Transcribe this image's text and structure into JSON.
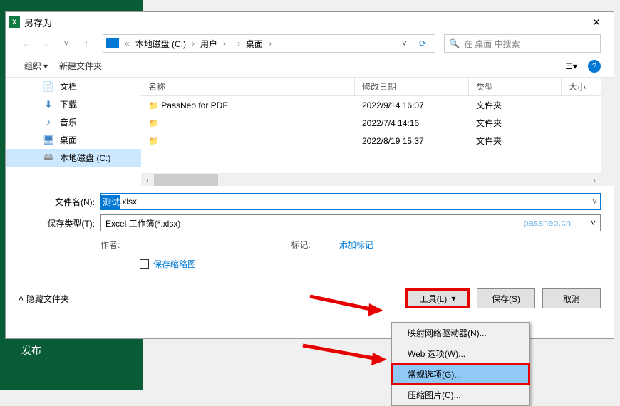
{
  "bg": {
    "publish": "发布"
  },
  "dialog": {
    "title": "另存为",
    "close": "✕"
  },
  "nav": {
    "back": "←",
    "fwd": "→",
    "dd": "˅",
    "up": "↑",
    "crumbs": {
      "c1": "本地磁盘 (C:)",
      "c2": "用户",
      "c3_redacted": "      ",
      "c4": "桌面"
    },
    "refresh": "⟳",
    "search_placeholder": "在 桌面 中搜索"
  },
  "toolbar": {
    "organize": "组织",
    "newfolder": "新建文件夹"
  },
  "sidebar": {
    "items": [
      {
        "icon": "📄",
        "label": "文档",
        "color": "#3b82c4"
      },
      {
        "icon": "⬇",
        "label": "下载",
        "color": "#3b82c4"
      },
      {
        "icon": "♪",
        "label": "音乐",
        "color": "#3b82c4"
      },
      {
        "icon": "🖥",
        "label": "桌面",
        "color": "#3b82c4"
      },
      {
        "icon": "🖴",
        "label": "本地磁盘 (C:)",
        "color": "#888"
      }
    ]
  },
  "files": {
    "cols": {
      "name": "名称",
      "date": "修改日期",
      "type": "类型",
      "size": "大小"
    },
    "rows": [
      {
        "name": "PassNeo for PDF",
        "date": "2022/9/14 16:07",
        "type": "文件夹"
      },
      {
        "name": " ",
        "date": "2022/7/4 14:16",
        "type": "文件夹"
      },
      {
        "name": " ",
        "date": "2022/8/19 15:37",
        "type": "文件夹"
      }
    ]
  },
  "form": {
    "filename_label": "文件名(N):",
    "filename_sel": "测试",
    "filename_ext": ".xlsx",
    "filetype_label": "保存类型(T):",
    "filetype_value": "Excel 工作簿(*.xlsx)",
    "author_label": "作者:",
    "author_value": "    ",
    "tag_label": "标记:",
    "tag_value": "添加标记",
    "thumb_label": "保存缩略图"
  },
  "bottom": {
    "hide": "隐藏文件夹",
    "tools": "工具(L)",
    "save": "保存(S)",
    "cancel": "取消"
  },
  "menu": {
    "items": [
      "映射网络驱动器(N)...",
      "Web 选项(W)...",
      "常规选项(G)...",
      "压缩图片(C)..."
    ]
  },
  "watermark": "passneo.cn"
}
